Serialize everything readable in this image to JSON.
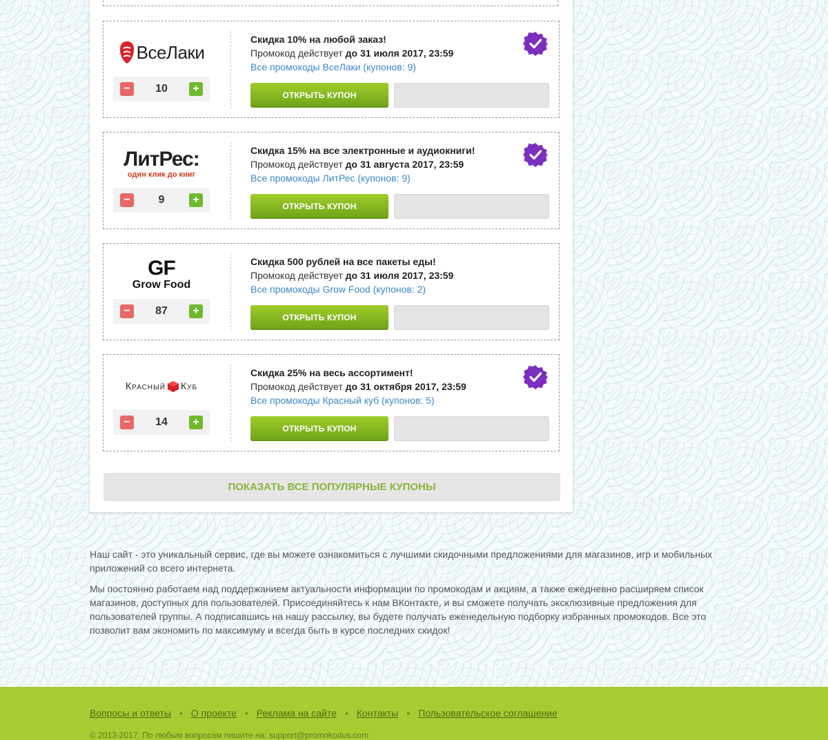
{
  "coupons": [
    {
      "logo_text": "ВсеЛаки",
      "count": "10",
      "title": "Скидка 10% на любой заказ!",
      "valid_prefix": "Промокод действует",
      "valid_date": "до 31 июля 2017, 23:59",
      "link": "Все промокоды ВсеЛаки (купонов: 9)",
      "button": "Открыть купон",
      "verified": true
    },
    {
      "logo_text": "ЛитРес:",
      "logo_sub": "один клик до книг",
      "count": "9",
      "title": "Скидка 15% на все электронные и аудиокниги!",
      "valid_prefix": "Промокод действует",
      "valid_date": "до 31 августа 2017, 23:59",
      "link": "Все промокоды ЛитРес (купонов: 9)",
      "button": "Открыть купон",
      "verified": true
    },
    {
      "logo_text": "GF",
      "logo_sub": "Grow Food",
      "count": "87",
      "title": "Скидка 500 рублей на все пакеты еды!",
      "valid_prefix": "Промокод действует",
      "valid_date": "до 31 июля 2017, 23:59",
      "link": "Все промокоды Grow Food (купонов: 2)",
      "button": "Открыть купон",
      "verified": false
    },
    {
      "logo_text": "Красный",
      "logo_text2": "Куб",
      "count": "14",
      "title": "Скидка 25% на весь ассортимент!",
      "valid_prefix": "Промокод действует",
      "valid_date": "до 31 октября 2017, 23:59",
      "link": "Все промокоды Красный куб (купонов: 5)",
      "button": "Открыть купон",
      "verified": true
    }
  ],
  "counter": {
    "minus": "−",
    "plus": "+"
  },
  "show_all": "Показать все популярные купоны",
  "about": [
    "Наш сайт - это уникальный сервис, где вы можете ознакомиться с лучшими скидочными предложениями для магазинов, игр и мобильных приложений со всего интернета.",
    "Мы постоянно работаем над поддержанием актуальности информации по промокодам и акциям, а также ежедневно расширяем список магазинов, доступных для пользователей. Присоединяйтесь к нам ВКонтакте, и вы сможете получать эксклюзивные предложения для пользователей группы. А подписавшись на нашу рассылку, вы будете получать еженедельную подборку избранных промокодов. Все это позволит вам экономить по максимуму и всегда быть в курсе последних скидок!"
  ],
  "footer": {
    "links": [
      "Вопросы и ответы",
      "О проекте",
      "Реклама на сайте",
      "Контакты",
      "Пользовательское соглашение"
    ],
    "separator": "•",
    "copyright": "© 2013-2017. По любым вопросам пишите на: support@promokodus.com"
  },
  "colors": {
    "accent_green": "#8bc21f",
    "link_blue": "#3b87c8",
    "verified_purple": "#7b2fbe",
    "footer_green": "#a7cb32",
    "minus_red": "#e86767"
  }
}
